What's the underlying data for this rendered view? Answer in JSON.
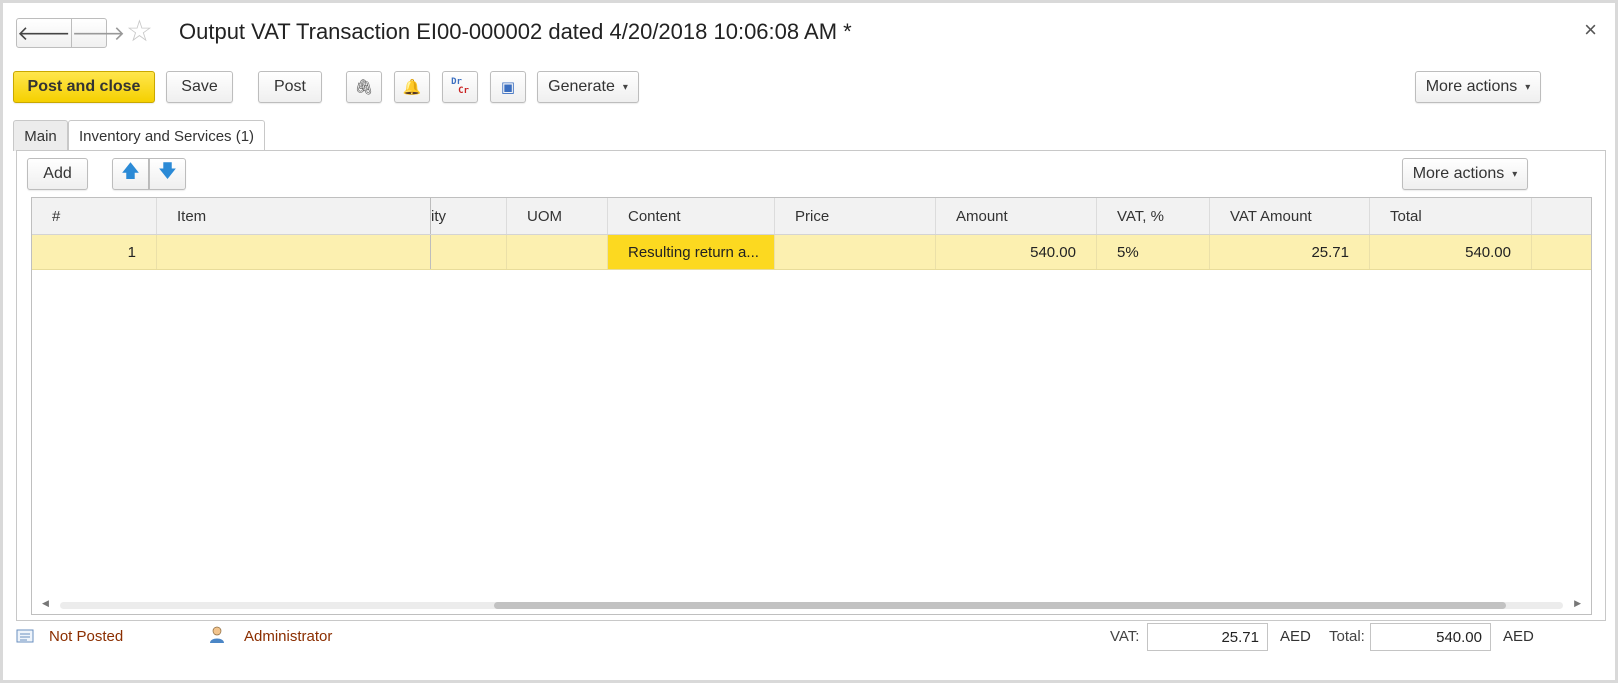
{
  "window": {
    "title": "Output VAT Transaction EI00-000002 dated 4/20/2018 10:06:08 AM *",
    "close_glyph": "×",
    "nav_back_glyph": "🡐",
    "nav_forward_glyph": "🡒",
    "favorite_glyph": "☆"
  },
  "toolbar": {
    "post_and_close": "Post and close",
    "save": "Save",
    "post": "Post",
    "attach_glyph": "🖇",
    "reminder_glyph": "🔔",
    "drcr_dr": "Dr",
    "drcr_cr": "Cr",
    "structure_glyph": "▣",
    "generate": "Generate",
    "more_actions": "More actions",
    "caret": "▾"
  },
  "tabs": [
    {
      "label": "Main",
      "active": false
    },
    {
      "label": "Inventory and Services (1)",
      "active": true
    }
  ],
  "table_toolbar": {
    "add": "Add",
    "move_up_glyph": "🡅",
    "move_down_glyph": "🡇",
    "more_actions": "More actions"
  },
  "table": {
    "columns": [
      "#",
      "Item",
      "ity",
      "UOM",
      "Content",
      "Price",
      "Amount",
      "VAT, %",
      "VAT Amount",
      "Total"
    ],
    "rows": [
      {
        "num": "1",
        "item": "",
        "quantity": "",
        "uom": "",
        "content": "Resulting return a...",
        "price": "",
        "amount": "540.00",
        "vat_rate": "5%",
        "vat_amount": "25.71",
        "total": "540.00"
      }
    ]
  },
  "footer": {
    "status": "Not Posted",
    "user": "Administrator",
    "vat_label": "VAT:",
    "vat_value": "25.71",
    "vat_currency": "AED",
    "total_label": "Total:",
    "total_value": "540.00",
    "total_currency": "AED"
  },
  "colors": {
    "primary_button": "#f5d000",
    "selected_row": "#fcf0b0",
    "current_cell": "#fcd920",
    "status_text": "#8b2e00",
    "arrow_blue": "#2b8ad6"
  }
}
